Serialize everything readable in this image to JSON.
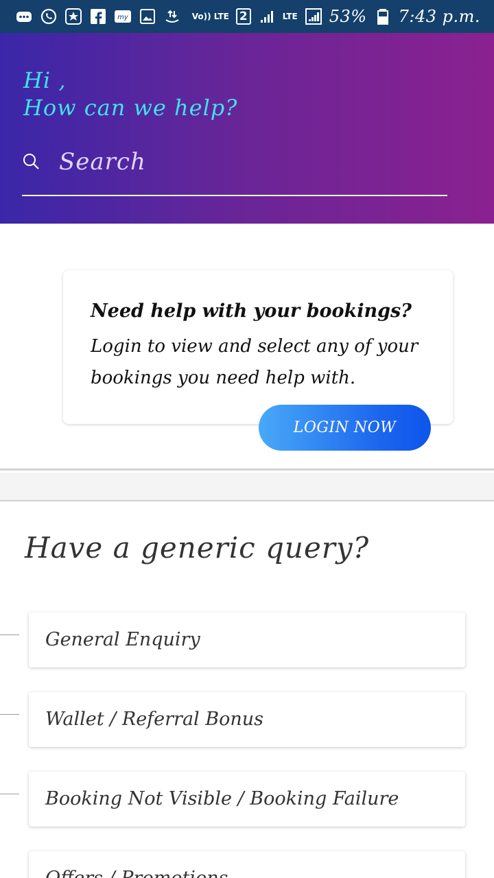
{
  "status_bar": {
    "volte": "Vo)) LTE",
    "sim": "2",
    "network": "LTE",
    "battery": "53%",
    "time": "7:43 p.m."
  },
  "header": {
    "greeting_line1": "Hi ,",
    "greeting_line2": "How can we help?",
    "search_placeholder": "Search"
  },
  "booking_card": {
    "title": "Need help with your bookings?",
    "description": "Login to view and select any of your bookings you need help with.",
    "login_label": "LOGIN NOW"
  },
  "generic": {
    "title": "Have a generic query?",
    "items": [
      {
        "label": "General Enquiry"
      },
      {
        "label": "Wallet / Referral Bonus"
      },
      {
        "label": "Booking Not Visible / Booking Failure"
      },
      {
        "label": "Offers / Promotions"
      }
    ]
  },
  "colors": {
    "status_bar": "#14406b",
    "header_start": "#3a27a8",
    "header_end": "#8b2190",
    "greeting": "#3fe3ec",
    "login_button": "#1c66ee"
  }
}
